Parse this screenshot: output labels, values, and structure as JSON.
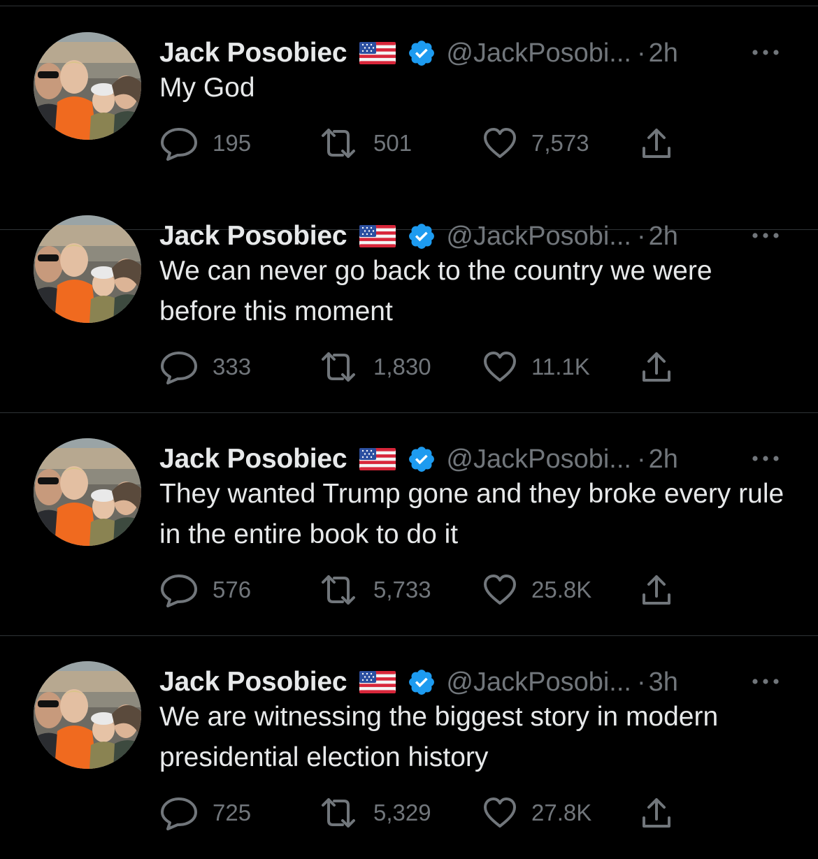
{
  "colors": {
    "background": "#000000",
    "primary_text": "#e7e9ea",
    "secondary_text": "#71767b",
    "verified_badge": "#1d9bf0",
    "divider": "#2f3336"
  },
  "tweets": [
    {
      "author": "Jack Posobiec",
      "flag_icon": "us-flag-icon",
      "verified_icon": "verified-badge-icon",
      "handle": "@JackPosobi...",
      "separator": "·",
      "time": "2h",
      "text": "My God",
      "replies": "195",
      "retweets": "501",
      "likes": "7,573"
    },
    {
      "author": "Jack Posobiec",
      "flag_icon": "us-flag-icon",
      "verified_icon": "verified-badge-icon",
      "handle": "@JackPosobi...",
      "separator": "·",
      "time": "2h",
      "text": "We can never go back to the country we were before this moment",
      "replies": "333",
      "retweets": "1,830",
      "likes": "11.1K"
    },
    {
      "author": "Jack Posobiec",
      "flag_icon": "us-flag-icon",
      "verified_icon": "verified-badge-icon",
      "handle": "@JackPosobi...",
      "separator": "·",
      "time": "2h",
      "text": "They wanted Trump gone and they broke every rule in the entire book to do it",
      "replies": "576",
      "retweets": "5,733",
      "likes": "25.8K"
    },
    {
      "author": "Jack Posobiec",
      "flag_icon": "us-flag-icon",
      "verified_icon": "verified-badge-icon",
      "handle": "@JackPosobi...",
      "separator": "·",
      "time": "3h",
      "text": "We are witnessing the biggest story in modern presidential election history",
      "replies": "725",
      "retweets": "5,329",
      "likes": "27.8K"
    }
  ]
}
